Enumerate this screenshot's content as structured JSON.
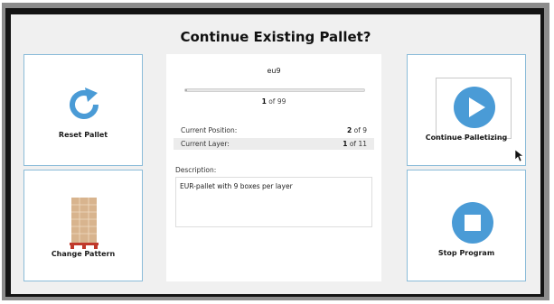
{
  "dialog": {
    "title": "Continue Existing Pallet?"
  },
  "tiles": {
    "reset": {
      "label": "Reset Pallet",
      "icon": "refresh-icon"
    },
    "pattern": {
      "label": "Change Pattern",
      "icon": "pallet-icon"
    },
    "continue": {
      "label": "Continue Palletizing",
      "icon": "play-icon"
    },
    "stop": {
      "label": "Stop Program",
      "icon": "stop-icon"
    }
  },
  "info": {
    "pattern_name": "eu9",
    "progress": {
      "current": "1",
      "of_text": "of 99",
      "fraction": 0.01
    },
    "rows": [
      {
        "label": "Current Position:",
        "value": "2",
        "of_text": "of 9"
      },
      {
        "label": "Current Layer:",
        "value": "1",
        "of_text": "of 11"
      }
    ],
    "description_label": "Description:",
    "description": "EUR-pallet with 9 boxes per layer"
  },
  "colors": {
    "accent": "#4a9bd6",
    "tile_border": "#8bbcd9",
    "background": "#f0f0f0",
    "pallet_box": "#d8b48e",
    "pallet_base": "#c0392b"
  }
}
